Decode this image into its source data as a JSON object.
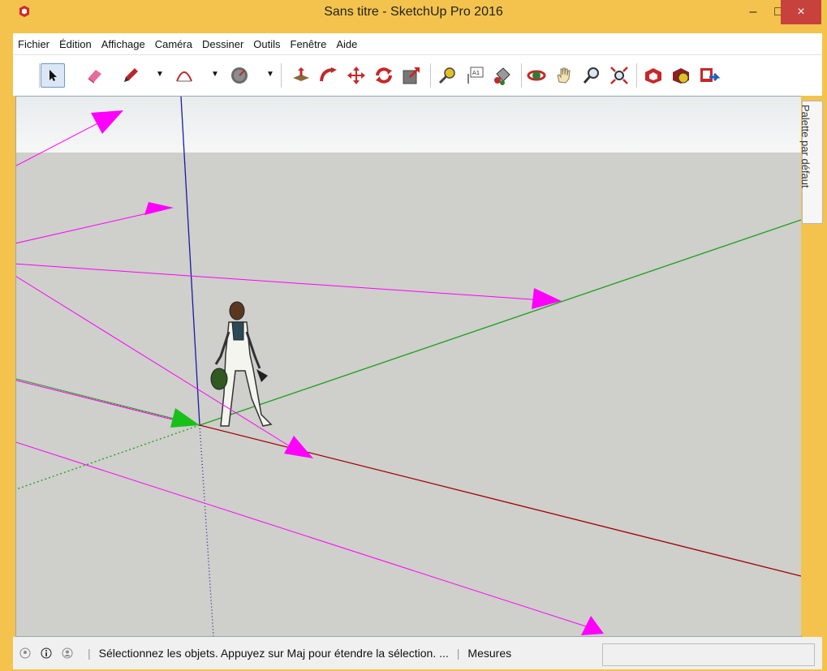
{
  "window": {
    "title": "Sans titre - SketchUp Pro 2016",
    "min_glyph": "–",
    "max_glyph": "□",
    "close_glyph": "×"
  },
  "menu": {
    "items": [
      "Fichier",
      "Édition",
      "Affichage",
      "Caméra",
      "Dessiner",
      "Outils",
      "Fenêtre",
      "Aide"
    ]
  },
  "toolbar": {
    "tools": [
      "select-icon",
      "eraser-icon",
      "pencil-icon",
      "arc-icon",
      "pie-icon",
      "push-pull-icon",
      "follow-me-icon",
      "move-icon",
      "rotate-icon",
      "scale-icon",
      "tape-measure-icon",
      "text-icon",
      "paint-bucket-icon",
      "orbit-icon",
      "pan-icon",
      "zoom-icon",
      "zoom-extents-icon",
      "warehouse-icon",
      "extension-icon",
      "share-icon"
    ]
  },
  "palette": {
    "label": "Palette par défaut"
  },
  "status": {
    "message": "Sélectionnez les objets. Appuyez sur Maj pour étendre la sélection. ...",
    "measure_label": "Mesures"
  },
  "colors": {
    "frame": "#f3c34d",
    "annotation": "#ff00ff",
    "axis_red": "#a00000",
    "axis_green": "#19a019",
    "axis_blue": "#1a1aa8"
  }
}
